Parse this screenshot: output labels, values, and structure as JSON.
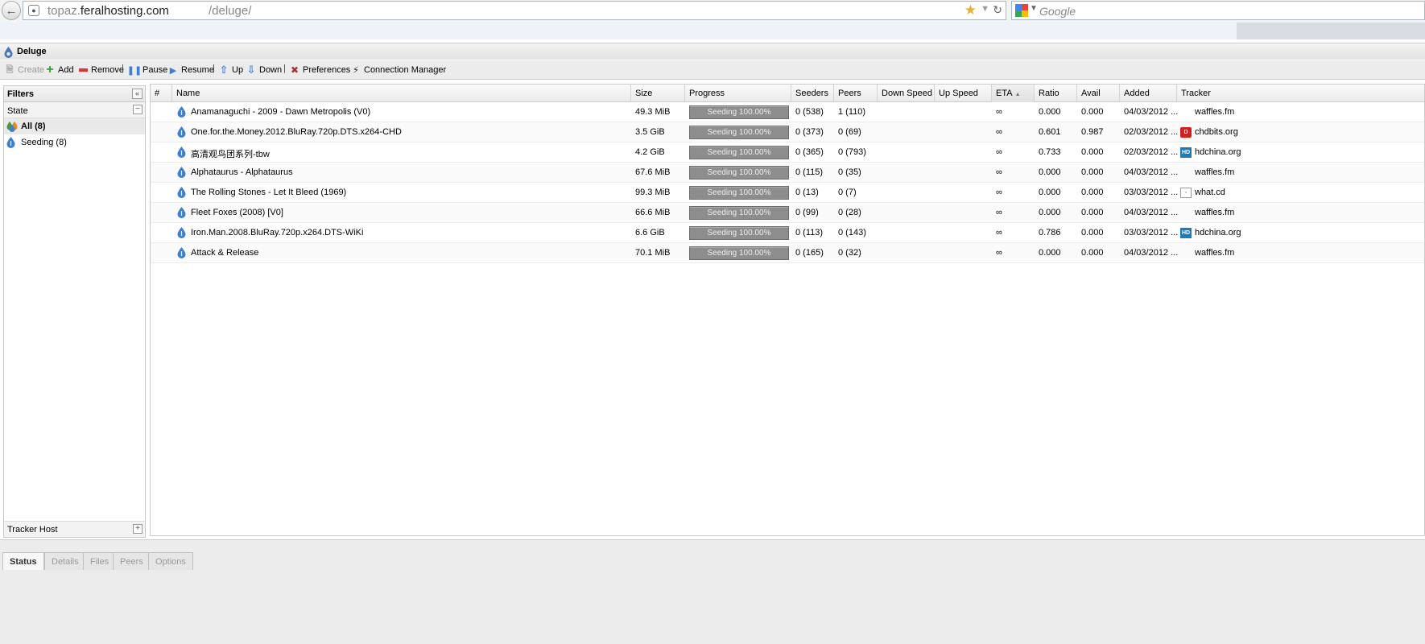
{
  "browser": {
    "url_host_prefix": "topaz.",
    "url_host_domain": "feralhosting.com",
    "url_path": "/deluge/",
    "search_placeholder": "Google"
  },
  "app": {
    "title": "Deluge"
  },
  "toolbar": {
    "create": "Create",
    "add": "Add",
    "remove": "Remove",
    "pause": "Pause",
    "resume": "Resume",
    "up": "Up",
    "down": "Down",
    "preferences": "Preferences",
    "connection_manager": "Connection Manager",
    "separator": "|"
  },
  "filters": {
    "title": "Filters",
    "state_title": "State",
    "state_items": [
      {
        "label": "All (8)",
        "icon": "all-states-icon"
      },
      {
        "label": "Seeding (8)",
        "icon": "seeding-icon"
      }
    ],
    "tracker_host": "Tracker Host"
  },
  "grid": {
    "columns": [
      "#",
      "Name",
      "Size",
      "Progress",
      "Seeders",
      "Peers",
      "Down Speed",
      "Up Speed",
      "ETA",
      "Ratio",
      "Avail",
      "Added",
      "Tracker"
    ],
    "sorted_column": "ETA",
    "rows": [
      {
        "name": "Anamanaguchi - 2009 - Dawn Metropolis (V0)",
        "size": "49.3 MiB",
        "progress": "Seeding 100.00%",
        "progress_value": 1.0,
        "seeders": "0 (538)",
        "peers": "1 (110)",
        "down": "",
        "up": "",
        "eta": "∞",
        "ratio": "0.000",
        "avail": "0.000",
        "added": "04/03/2012 ...",
        "tracker": "waffles.fm",
        "tracker_icon": ""
      },
      {
        "name": "One.for.the.Money.2012.BluRay.720p.DTS.x264-CHD",
        "size": "3.5 GiB",
        "progress": "Seeding 100.00%",
        "progress_value": 1.0,
        "seeders": "0 (373)",
        "peers": "0 (69)",
        "down": "",
        "up": "",
        "eta": "∞",
        "ratio": "0.601",
        "avail": "0.987",
        "added": "02/03/2012 ...",
        "tracker": "chdbits.org",
        "tracker_icon": "red"
      },
      {
        "name": "高清观鸟团系列-tbw",
        "size": "4.2 GiB",
        "progress": "Seeding 100.00%",
        "progress_value": 1.0,
        "seeders": "0 (365)",
        "peers": "0 (793)",
        "down": "",
        "up": "",
        "eta": "∞",
        "ratio": "0.733",
        "avail": "0.000",
        "added": "02/03/2012 ...",
        "tracker": "hdchina.org",
        "tracker_icon": "hd"
      },
      {
        "name": "Alphataurus - Alphataurus",
        "size": "67.6 MiB",
        "progress": "Seeding 100.00%",
        "progress_value": 1.0,
        "seeders": "0 (115)",
        "peers": "0 (35)",
        "down": "",
        "up": "",
        "eta": "∞",
        "ratio": "0.000",
        "avail": "0.000",
        "added": "04/03/2012 ...",
        "tracker": "waffles.fm",
        "tracker_icon": ""
      },
      {
        "name": "The Rolling Stones - Let It Bleed (1969)",
        "size": "99.3 MiB",
        "progress": "Seeding 100.00%",
        "progress_value": 1.0,
        "seeders": "0 (13)",
        "peers": "0 (7)",
        "down": "",
        "up": "",
        "eta": "∞",
        "ratio": "0.000",
        "avail": "0.000",
        "added": "03/03/2012 ...",
        "tracker": "what.cd",
        "tracker_icon": "grey"
      },
      {
        "name": "Fleet Foxes (2008) [V0]",
        "size": "66.6 MiB",
        "progress": "Seeding 100.00%",
        "progress_value": 1.0,
        "seeders": "0 (99)",
        "peers": "0 (28)",
        "down": "",
        "up": "",
        "eta": "∞",
        "ratio": "0.000",
        "avail": "0.000",
        "added": "04/03/2012 ...",
        "tracker": "waffles.fm",
        "tracker_icon": ""
      },
      {
        "name": "Iron.Man.2008.BluRay.720p.x264.DTS-WiKi",
        "size": "6.6 GiB",
        "progress": "Seeding 100.00%",
        "progress_value": 1.0,
        "seeders": "0 (113)",
        "peers": "0 (143)",
        "down": "",
        "up": "",
        "eta": "∞",
        "ratio": "0.786",
        "avail": "0.000",
        "added": "03/03/2012 ...",
        "tracker": "hdchina.org",
        "tracker_icon": "hd"
      },
      {
        "name": "Attack & Release",
        "size": "70.1 MiB",
        "progress": "Seeding 100.00%",
        "progress_value": 1.0,
        "seeders": "0 (165)",
        "peers": "0 (32)",
        "down": "",
        "up": "",
        "eta": "∞",
        "ratio": "0.000",
        "avail": "0.000",
        "added": "04/03/2012 ...",
        "tracker": "waffles.fm",
        "tracker_icon": ""
      }
    ]
  },
  "bottom_tabs": [
    {
      "label": "Status",
      "active": true
    },
    {
      "label": "Details",
      "active": false
    },
    {
      "label": "Files",
      "active": false
    },
    {
      "label": "Peers",
      "active": false
    },
    {
      "label": "Options",
      "active": false
    }
  ],
  "colors": {
    "progress_fill": "#8d8d8d",
    "accent": "#3d7fd1"
  }
}
